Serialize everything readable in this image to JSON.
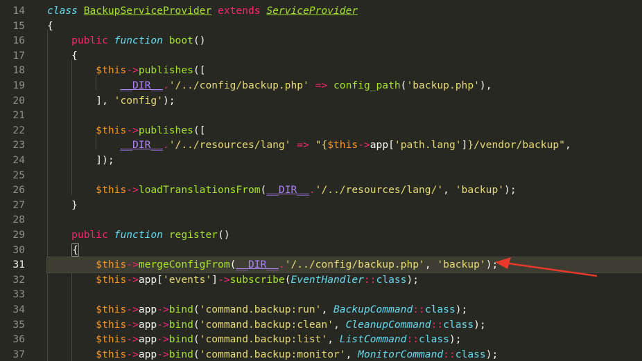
{
  "editor": {
    "lines": [
      {
        "n": "14",
        "tokens": [
          [
            "kw",
            "class"
          ],
          [
            "plain",
            " "
          ],
          [
            "cls",
            "BackupServiceProvider"
          ],
          [
            "plain",
            " "
          ],
          [
            "mod",
            "extends"
          ],
          [
            "plain",
            " "
          ],
          [
            "cls-it",
            "ServiceProvider"
          ]
        ]
      },
      {
        "n": "15",
        "tokens": [
          [
            "plain",
            "{"
          ]
        ]
      },
      {
        "n": "16",
        "tokens": [
          [
            "plain",
            "    "
          ],
          [
            "mod",
            "public"
          ],
          [
            "plain",
            " "
          ],
          [
            "kw",
            "function"
          ],
          [
            "plain",
            " "
          ],
          [
            "fn",
            "boot"
          ],
          [
            "plain",
            "()"
          ]
        ]
      },
      {
        "n": "17",
        "tokens": [
          [
            "plain",
            "    {"
          ]
        ]
      },
      {
        "n": "18",
        "tokens": [
          [
            "plain",
            "        "
          ],
          [
            "var",
            "$this"
          ],
          [
            "op",
            "->"
          ],
          [
            "fn",
            "publishes"
          ],
          [
            "plain",
            "(["
          ]
        ]
      },
      {
        "n": "19",
        "tokens": [
          [
            "plain",
            "            "
          ],
          [
            "const",
            "__DIR__"
          ],
          [
            "op",
            "."
          ],
          [
            "str",
            "'/../config/backup.php'"
          ],
          [
            "plain",
            " "
          ],
          [
            "op",
            "=>"
          ],
          [
            "plain",
            " "
          ],
          [
            "fn",
            "config_path"
          ],
          [
            "plain",
            "("
          ],
          [
            "str",
            "'backup.php'"
          ],
          [
            "plain",
            "),"
          ]
        ]
      },
      {
        "n": "20",
        "tokens": [
          [
            "plain",
            "        ], "
          ],
          [
            "str",
            "'config'"
          ],
          [
            "plain",
            ");"
          ]
        ]
      },
      {
        "n": "21",
        "tokens": []
      },
      {
        "n": "22",
        "tokens": [
          [
            "plain",
            "        "
          ],
          [
            "var",
            "$this"
          ],
          [
            "op",
            "->"
          ],
          [
            "fn",
            "publishes"
          ],
          [
            "plain",
            "(["
          ]
        ]
      },
      {
        "n": "23",
        "tokens": [
          [
            "plain",
            "            "
          ],
          [
            "const",
            "__DIR__"
          ],
          [
            "op",
            "."
          ],
          [
            "str",
            "'/../resources/lang'"
          ],
          [
            "plain",
            " "
          ],
          [
            "op",
            "=>"
          ],
          [
            "plain",
            " "
          ],
          [
            "str",
            "\"{"
          ],
          [
            "var",
            "$this"
          ],
          [
            "op",
            "->"
          ],
          [
            "plain",
            "app["
          ],
          [
            "str",
            "'path.lang'"
          ],
          [
            "plain",
            "]"
          ],
          [
            "str",
            "}/vendor/backup\""
          ],
          [
            "plain",
            ","
          ]
        ]
      },
      {
        "n": "24",
        "tokens": [
          [
            "plain",
            "        ]);"
          ]
        ]
      },
      {
        "n": "25",
        "tokens": []
      },
      {
        "n": "26",
        "tokens": [
          [
            "plain",
            "        "
          ],
          [
            "var",
            "$this"
          ],
          [
            "op",
            "->"
          ],
          [
            "fn",
            "loadTranslationsFrom"
          ],
          [
            "plain",
            "("
          ],
          [
            "const",
            "__DIR__"
          ],
          [
            "op",
            "."
          ],
          [
            "str",
            "'/../resources/lang/'"
          ],
          [
            "plain",
            ", "
          ],
          [
            "str",
            "'backup'"
          ],
          [
            "plain",
            ");"
          ]
        ]
      },
      {
        "n": "27",
        "tokens": [
          [
            "plain",
            "    }"
          ]
        ]
      },
      {
        "n": "28",
        "tokens": []
      },
      {
        "n": "29",
        "tokens": [
          [
            "plain",
            "    "
          ],
          [
            "mod",
            "public"
          ],
          [
            "plain",
            " "
          ],
          [
            "kw",
            "function"
          ],
          [
            "plain",
            " "
          ],
          [
            "fn",
            "register"
          ],
          [
            "plain",
            "()"
          ]
        ]
      },
      {
        "n": "30",
        "tokens": [
          [
            "plain",
            "    "
          ],
          [
            "bracket",
            "{"
          ]
        ]
      },
      {
        "n": "31",
        "active": true,
        "tokens": [
          [
            "plain",
            "        "
          ],
          [
            "var",
            "$this"
          ],
          [
            "op",
            "->"
          ],
          [
            "fn",
            "mergeConfigFrom"
          ],
          [
            "plain",
            "("
          ],
          [
            "const",
            "__DIR__"
          ],
          [
            "op",
            "."
          ],
          [
            "str",
            "'/../config/backup.php'"
          ],
          [
            "plain",
            ", "
          ],
          [
            "str",
            "'backup'"
          ],
          [
            "plain",
            ");"
          ]
        ]
      },
      {
        "n": "32",
        "tokens": [
          [
            "plain",
            "        "
          ],
          [
            "var",
            "$this"
          ],
          [
            "op",
            "->"
          ],
          [
            "plain",
            "app["
          ],
          [
            "str",
            "'events'"
          ],
          [
            "plain",
            "]"
          ],
          [
            "op",
            "->"
          ],
          [
            "fn",
            "subscribe"
          ],
          [
            "plain",
            "("
          ],
          [
            "ref",
            "EventHandler"
          ],
          [
            "op",
            "::"
          ],
          [
            "kw-plain",
            "class"
          ],
          [
            "plain",
            ");"
          ]
        ]
      },
      {
        "n": "33",
        "tokens": []
      },
      {
        "n": "34",
        "tokens": [
          [
            "plain",
            "        "
          ],
          [
            "var",
            "$this"
          ],
          [
            "op",
            "->"
          ],
          [
            "plain",
            "app"
          ],
          [
            "op",
            "->"
          ],
          [
            "fn",
            "bind"
          ],
          [
            "plain",
            "("
          ],
          [
            "str",
            "'command.backup:run'"
          ],
          [
            "plain",
            ", "
          ],
          [
            "ref",
            "BackupCommand"
          ],
          [
            "op",
            "::"
          ],
          [
            "kw-plain",
            "class"
          ],
          [
            "plain",
            ");"
          ]
        ]
      },
      {
        "n": "35",
        "tokens": [
          [
            "plain",
            "        "
          ],
          [
            "var",
            "$this"
          ],
          [
            "op",
            "->"
          ],
          [
            "plain",
            "app"
          ],
          [
            "op",
            "->"
          ],
          [
            "fn",
            "bind"
          ],
          [
            "plain",
            "("
          ],
          [
            "str",
            "'command.backup:clean'"
          ],
          [
            "plain",
            ", "
          ],
          [
            "ref",
            "CleanupCommand"
          ],
          [
            "op",
            "::"
          ],
          [
            "kw-plain",
            "class"
          ],
          [
            "plain",
            ");"
          ]
        ]
      },
      {
        "n": "36",
        "tokens": [
          [
            "plain",
            "        "
          ],
          [
            "var",
            "$this"
          ],
          [
            "op",
            "->"
          ],
          [
            "plain",
            "app"
          ],
          [
            "op",
            "->"
          ],
          [
            "fn",
            "bind"
          ],
          [
            "plain",
            "("
          ],
          [
            "str",
            "'command.backup:list'"
          ],
          [
            "plain",
            ", "
          ],
          [
            "ref",
            "ListCommand"
          ],
          [
            "op",
            "::"
          ],
          [
            "kw-plain",
            "class"
          ],
          [
            "plain",
            ");"
          ]
        ]
      },
      {
        "n": "37",
        "tokens": [
          [
            "plain",
            "        "
          ],
          [
            "var",
            "$this"
          ],
          [
            "op",
            "->"
          ],
          [
            "plain",
            "app"
          ],
          [
            "op",
            "->"
          ],
          [
            "fn",
            "bind"
          ],
          [
            "plain",
            "("
          ],
          [
            "str",
            "'command.backup:monitor'"
          ],
          [
            "plain",
            ", "
          ],
          [
            "ref",
            "MonitorCommand"
          ],
          [
            "op",
            "::"
          ],
          [
            "kw-plain",
            "class"
          ],
          [
            "plain",
            ");"
          ]
        ]
      }
    ]
  },
  "annotation": {
    "arrow_color": "#e8392b",
    "points_to_line": "31"
  },
  "theme": {
    "background": "#272822",
    "active_line": "#3e3d32",
    "gutter_text": "#90908a"
  }
}
